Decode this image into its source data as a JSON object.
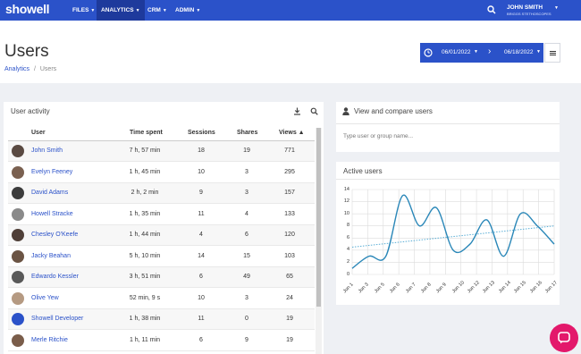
{
  "app": {
    "logo": "showell",
    "nav": [
      {
        "label": "FILES"
      },
      {
        "label": "ANALYTICS"
      },
      {
        "label": "CRM"
      },
      {
        "label": "ADMIN"
      }
    ],
    "user_name": "JOHN SMITH",
    "user_company": "BRIGGS STETHOSCOPES"
  },
  "page": {
    "title": "Users",
    "breadcrumb": [
      "Analytics",
      "/",
      "Users"
    ],
    "date_from": "06/01/2022",
    "date_to": "06/18/2022"
  },
  "activity": {
    "title": "User activity",
    "columns": {
      "user": "User",
      "time": "Time spent",
      "sessions": "Sessions",
      "shares": "Shares",
      "views": "Views ▲"
    },
    "rows": [
      {
        "name": "John Smith",
        "time": "7 h, 57 min",
        "sessions": "18",
        "shares": "19",
        "views": "771"
      },
      {
        "name": "Evelyn Feeney",
        "time": "1 h, 45 min",
        "sessions": "10",
        "shares": "3",
        "views": "295"
      },
      {
        "name": "David Adams",
        "time": "2 h, 2 min",
        "sessions": "9",
        "shares": "3",
        "views": "157"
      },
      {
        "name": "Howell Stracke",
        "time": "1 h, 35 min",
        "sessions": "11",
        "shares": "4",
        "views": "133"
      },
      {
        "name": "Chesley O'Keefe",
        "time": "1 h, 44 min",
        "sessions": "4",
        "shares": "6",
        "views": "120"
      },
      {
        "name": "Jacky Beahan",
        "time": "5 h, 10 min",
        "sessions": "14",
        "shares": "15",
        "views": "103"
      },
      {
        "name": "Edwardo Kessler",
        "time": "3 h, 51 min",
        "sessions": "6",
        "shares": "49",
        "views": "65"
      },
      {
        "name": "Olive Yew",
        "time": "52 min, 9 s",
        "sessions": "10",
        "shares": "3",
        "views": "24"
      },
      {
        "name": "Showell Developer",
        "time": "1 h, 38 min",
        "sessions": "11",
        "shares": "0",
        "views": "19"
      },
      {
        "name": "Merle Ritchie",
        "time": "1 h, 11 min",
        "sessions": "6",
        "shares": "9",
        "views": "19"
      }
    ]
  },
  "compare": {
    "title": "View and compare users",
    "placeholder": "Type user or group name..."
  },
  "active": {
    "title": "Active users"
  },
  "chart_data": {
    "type": "line",
    "title": "Active users",
    "x": [
      "Jun 1",
      "Jun 3",
      "Jun 5",
      "Jun 6",
      "Jun 7",
      "Jun 8",
      "Jun 9",
      "Jun 10",
      "Jun 12",
      "Jun 13",
      "Jun 14",
      "Jun 15",
      "Jun 16",
      "Jun 17"
    ],
    "y": [
      1,
      3,
      3,
      13,
      8,
      11,
      4,
      5,
      9,
      3,
      10,
      8,
      5
    ],
    "trend": [
      4.5,
      8
    ],
    "ylim": [
      0,
      14
    ],
    "yticks": [
      0,
      2,
      4,
      6,
      8,
      10,
      12,
      14
    ],
    "grid": true,
    "colors": {
      "line": "#2a87b8",
      "trend": "#5aaed6"
    }
  }
}
